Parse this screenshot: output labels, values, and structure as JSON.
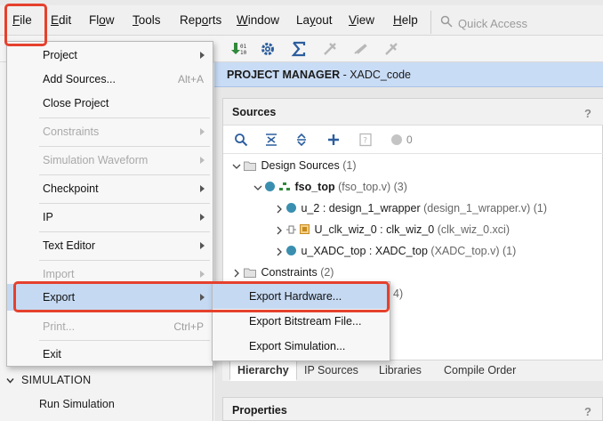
{
  "menubar": {
    "items": [
      {
        "label": "File",
        "mnemonic": "F",
        "rest": "ile"
      },
      {
        "label": "Edit",
        "mnemonic": "E",
        "rest": "dit"
      },
      {
        "label": "Flow",
        "pre": "Fl",
        "mnemonic": "o",
        "rest": "w"
      },
      {
        "label": "Tools",
        "mnemonic": "T",
        "rest": "ools"
      },
      {
        "label": "Reports",
        "pre": "Rep",
        "mnemonic": "o",
        "rest": "rts"
      },
      {
        "label": "Window",
        "mnemonic": "W",
        "rest": "indow"
      },
      {
        "label": "Layout",
        "pre": "La",
        "mnemonic": "y",
        "rest": "out"
      },
      {
        "label": "View",
        "mnemonic": "V",
        "rest": "iew"
      },
      {
        "label": "Help",
        "mnemonic": "H",
        "rest": "elp"
      }
    ],
    "quick_access_placeholder": "Quick Access"
  },
  "file_menu": {
    "items": [
      {
        "label": "Project",
        "submenu": true,
        "enabled": true
      },
      {
        "label": "Add Sources...",
        "shortcut": "Alt+A",
        "enabled": true
      },
      {
        "label": "Close Project",
        "enabled": true
      },
      {
        "label": "Constraints",
        "submenu": true,
        "enabled": false
      },
      {
        "label": "Simulation Waveform",
        "submenu": true,
        "enabled": false
      },
      {
        "label": "Checkpoint",
        "submenu": true,
        "enabled": true
      },
      {
        "label": "IP",
        "submenu": true,
        "enabled": true
      },
      {
        "label": "Text Editor",
        "submenu": true,
        "enabled": true
      },
      {
        "label": "Import",
        "submenu": true,
        "enabled": false
      },
      {
        "label": "Export",
        "submenu": true,
        "enabled": true,
        "highlighted": true
      },
      {
        "label": "Print...",
        "shortcut": "Ctrl+P",
        "enabled": false
      },
      {
        "label": "Exit",
        "enabled": true
      }
    ]
  },
  "export_submenu": {
    "items": [
      {
        "label": "Export Hardware...",
        "highlighted": true
      },
      {
        "label": "Export Bitstream File..."
      },
      {
        "label": "Export Simulation..."
      }
    ]
  },
  "flow_navigator": {
    "section": "SIMULATION",
    "run_simulation": "Run Simulation"
  },
  "project_manager": {
    "title_bold": "PROJECT MANAGER",
    "title_rest": " - XADC_code"
  },
  "sources": {
    "title": "Sources",
    "help": "?",
    "badge_count": "0",
    "tree": [
      {
        "label": "Design Sources",
        "meta": " (1)"
      },
      {
        "label": "fso_top",
        "meta": " (fso_top.v) (3)"
      },
      {
        "label": "u_2 : design_1_wrapper",
        "meta": " (design_1_wrapper.v) (1)"
      },
      {
        "label": "U_clk_wiz_0 : clk_wiz_0",
        "meta": " (clk_wiz_0.xci)"
      },
      {
        "label": "u_XADC_top : XADC_top",
        "meta": " (XADC_top.v) (1)"
      },
      {
        "label": "Constraints",
        "meta": " (2)"
      },
      {
        "label": "",
        "meta": "4)"
      }
    ],
    "tabs": [
      "Hierarchy",
      "IP Sources",
      "Libraries",
      "Compile Order"
    ]
  },
  "properties": {
    "title": "Properties",
    "help": "?"
  },
  "colors": {
    "callout": "#e5412d",
    "highlight": "#c5d9f2",
    "header_blue": "#c9dcf5",
    "dot_teal": "#3a8fb0"
  }
}
